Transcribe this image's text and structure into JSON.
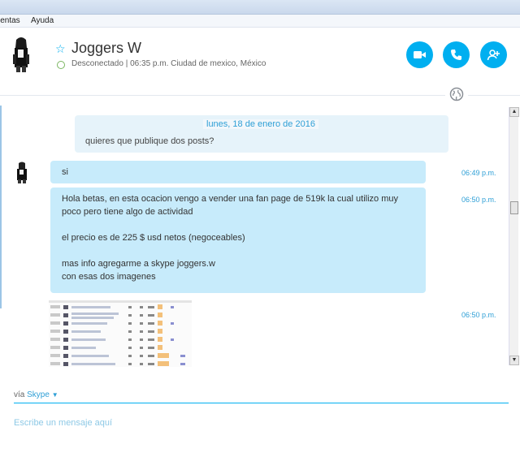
{
  "menu": {
    "item1": "ientas",
    "item2": "Ayuda"
  },
  "contact": {
    "name": "Joggers W",
    "status": "Desconectado",
    "status_detail": "06:35 p.m. Ciudad de mexico, México"
  },
  "header_buttons": [
    {
      "icon": "video-camera-icon",
      "label": "Videollamada"
    },
    {
      "icon": "phone-icon",
      "label": "Llamar"
    },
    {
      "icon": "add-person-icon",
      "label": "Agregar personas"
    }
  ],
  "conversation": {
    "date_separator": "lunes, 18 de enero de 2016",
    "previous_message": "quieres que publique dos posts?",
    "messages": [
      {
        "text": "si",
        "time": "06:49 p.m."
      },
      {
        "lines": [
          "Hola betas, en esta ocacion vengo a vender una fan page de 519k la cual utilizo muy",
          "poco pero tiene algo de actividad",
          "",
          "el precio es de 225 $ usd netos (negoceables)",
          "",
          "mas info agregarme a skype joggers.w",
          "con esas dos imagenes"
        ],
        "time": "06:50 p.m."
      },
      {
        "type": "image",
        "time": "06:50 p.m."
      }
    ]
  },
  "compose": {
    "via_prefix": "vía",
    "via_service": "Skype",
    "placeholder": "Escribe un mensaje aquí"
  },
  "colors": {
    "accent": "#00aff0",
    "bubble": "#c7ebfb",
    "link": "#2e9fd6",
    "status_offline": "#7bb661"
  }
}
